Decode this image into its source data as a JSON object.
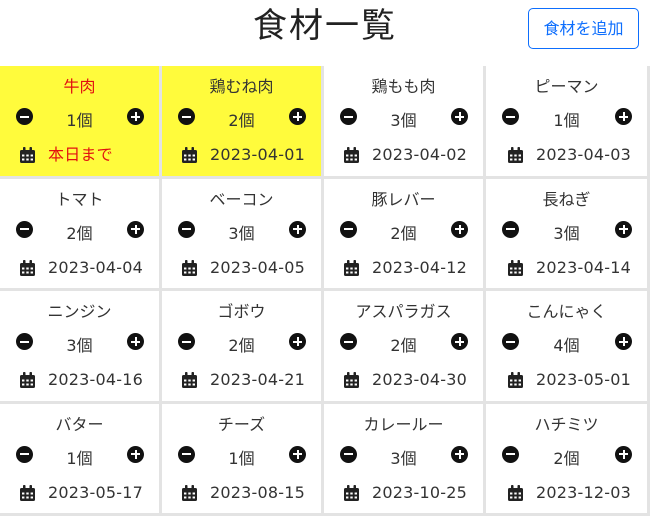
{
  "header": {
    "title": "食材一覧",
    "add_button_label": "食材を追加"
  },
  "colors": {
    "highlight": "#fffb3c",
    "warning_text": "#e21010",
    "accent": "#0d6efd"
  },
  "items": [
    {
      "name": "牛肉",
      "qty": "1個",
      "date": "本日まで",
      "highlight": true,
      "warn": true
    },
    {
      "name": "鶏むね肉",
      "qty": "2個",
      "date": "2023-04-01",
      "highlight": true,
      "warn": false
    },
    {
      "name": "鶏もも肉",
      "qty": "3個",
      "date": "2023-04-02",
      "highlight": false,
      "warn": false
    },
    {
      "name": "ピーマン",
      "qty": "1個",
      "date": "2023-04-03",
      "highlight": false,
      "warn": false
    },
    {
      "name": "トマト",
      "qty": "2個",
      "date": "2023-04-04",
      "highlight": false,
      "warn": false
    },
    {
      "name": "ベーコン",
      "qty": "3個",
      "date": "2023-04-05",
      "highlight": false,
      "warn": false
    },
    {
      "name": "豚レバー",
      "qty": "2個",
      "date": "2023-04-12",
      "highlight": false,
      "warn": false
    },
    {
      "name": "長ねぎ",
      "qty": "3個",
      "date": "2023-04-14",
      "highlight": false,
      "warn": false
    },
    {
      "name": "ニンジン",
      "qty": "3個",
      "date": "2023-04-16",
      "highlight": false,
      "warn": false
    },
    {
      "name": "ゴボウ",
      "qty": "2個",
      "date": "2023-04-21",
      "highlight": false,
      "warn": false
    },
    {
      "name": "アスパラガス",
      "qty": "2個",
      "date": "2023-04-30",
      "highlight": false,
      "warn": false
    },
    {
      "name": "こんにゃく",
      "qty": "4個",
      "date": "2023-05-01",
      "highlight": false,
      "warn": false
    },
    {
      "name": "バター",
      "qty": "1個",
      "date": "2023-05-17",
      "highlight": false,
      "warn": false
    },
    {
      "name": "チーズ",
      "qty": "1個",
      "date": "2023-08-15",
      "highlight": false,
      "warn": false
    },
    {
      "name": "カレールー",
      "qty": "3個",
      "date": "2023-10-25",
      "highlight": false,
      "warn": false
    },
    {
      "name": "ハチミツ",
      "qty": "2個",
      "date": "2023-12-03",
      "highlight": false,
      "warn": false
    }
  ],
  "icons": {
    "decrement": "minus-circle-icon",
    "increment": "plus-circle-icon",
    "date": "calendar-icon"
  }
}
